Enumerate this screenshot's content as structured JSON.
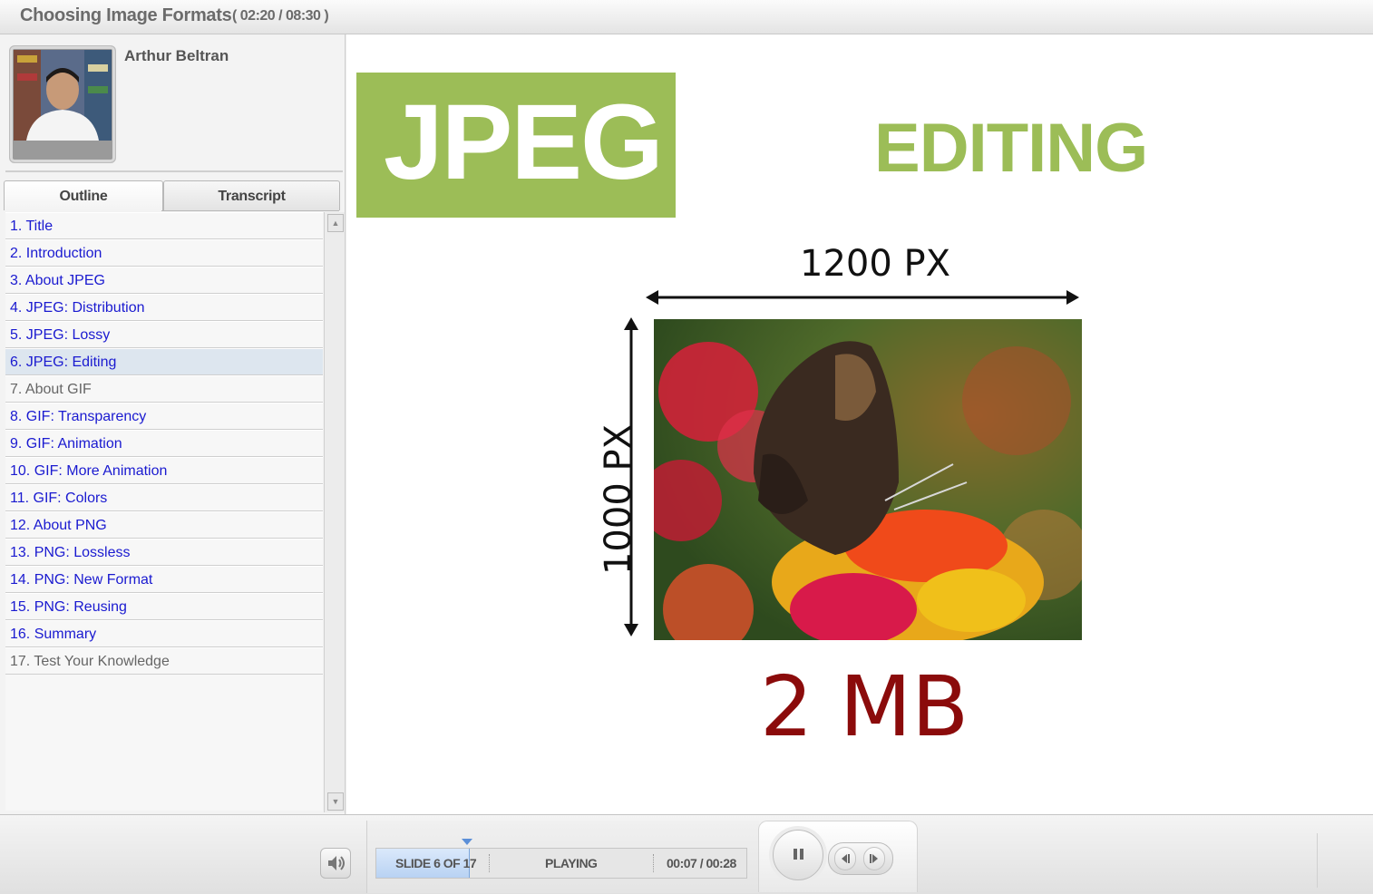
{
  "header": {
    "course_title": "Choosing Image Formats",
    "course_time": "( 02:20 / 08:30 )"
  },
  "presenter": {
    "name": "Arthur Beltran"
  },
  "tabs": [
    {
      "label": "Outline"
    },
    {
      "label": "Transcript"
    }
  ],
  "outline": [
    {
      "label": "1. Title"
    },
    {
      "label": "2. Introduction"
    },
    {
      "label": "3. About JPEG"
    },
    {
      "label": "4. JPEG: Distribution"
    },
    {
      "label": "5. JPEG: Lossy"
    },
    {
      "label": "6. JPEG: Editing"
    },
    {
      "label": "7. About GIF"
    },
    {
      "label": "8. GIF: Transparency"
    },
    {
      "label": "9. GIF: Animation"
    },
    {
      "label": "10.  GIF: More Animation"
    },
    {
      "label": "11.  GIF: Colors"
    },
    {
      "label": "12.  About PNG"
    },
    {
      "label": "13.  PNG: Lossless"
    },
    {
      "label": "14.  PNG: New Format"
    },
    {
      "label": "15.  PNG: Reusing"
    },
    {
      "label": "16.  Summary"
    },
    {
      "label": "17.  Test Your Knowledge"
    }
  ],
  "slide": {
    "format_label": "JPEG",
    "topic_label": "EDITING",
    "width_label": "1200 PX",
    "height_label": "1000 PX",
    "size_label": "2 MB"
  },
  "player": {
    "slide_counter": "SLIDE 6 OF 17",
    "status": "PLAYING",
    "time": "00:07 / 00:28",
    "progress_fraction": 0.25
  },
  "colors": {
    "accent_green": "#9cbd57",
    "size_red": "#8b0b0b",
    "link_blue": "#1a1ad0"
  },
  "icons": [
    "speaker-icon",
    "pause-icon",
    "previous-icon",
    "next-icon",
    "scroll-up-icon",
    "scroll-down-icon"
  ]
}
